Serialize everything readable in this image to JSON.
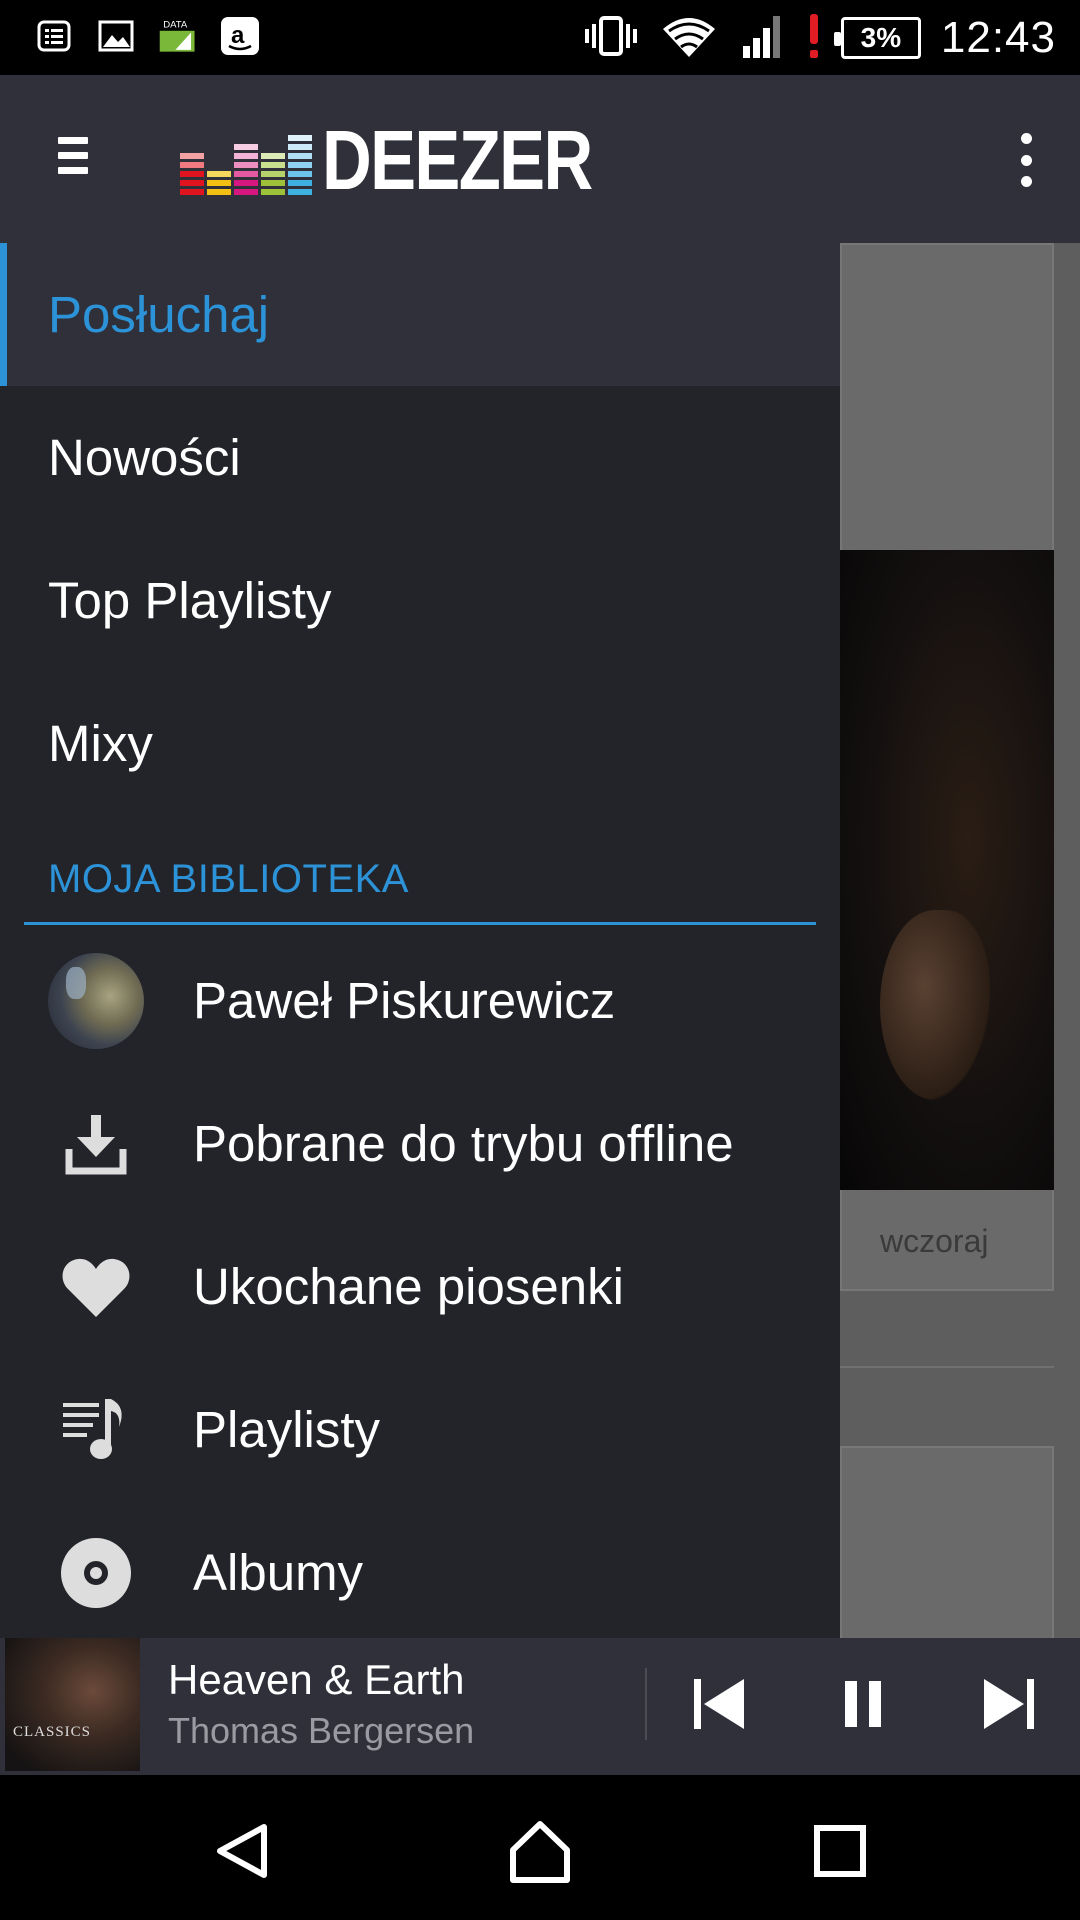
{
  "status_bar": {
    "data_label": "DATA",
    "battery": "3%",
    "time": "12:43"
  },
  "app_bar": {
    "logo_text": "DEEZER"
  },
  "drawer": {
    "nav_items": [
      {
        "label": "Posłuchaj",
        "active": true
      },
      {
        "label": "Nowości",
        "active": false
      },
      {
        "label": "Top Playlisty",
        "active": false
      },
      {
        "label": "Mixy",
        "active": false
      }
    ],
    "section_title": "MOJA BIBLIOTEKA",
    "library_items": [
      {
        "label": "Paweł Piskurewicz",
        "icon": "avatar"
      },
      {
        "label": "Pobrane do trybu offline",
        "icon": "download-icon"
      },
      {
        "label": "Ukochane piosenki",
        "icon": "heart-icon"
      },
      {
        "label": "Playlisty",
        "icon": "playlist-icon"
      },
      {
        "label": "Albumy",
        "icon": "album-icon"
      }
    ]
  },
  "background": {
    "card_date": "wczoraj"
  },
  "player": {
    "cover_text": "CLASSICS",
    "title": "Heaven & Earth",
    "artist": "Thomas Bergersen"
  },
  "colors": {
    "accent": "#2d93d8",
    "drawer_bg": "#23242a",
    "app_bar_bg": "#2f3039"
  }
}
